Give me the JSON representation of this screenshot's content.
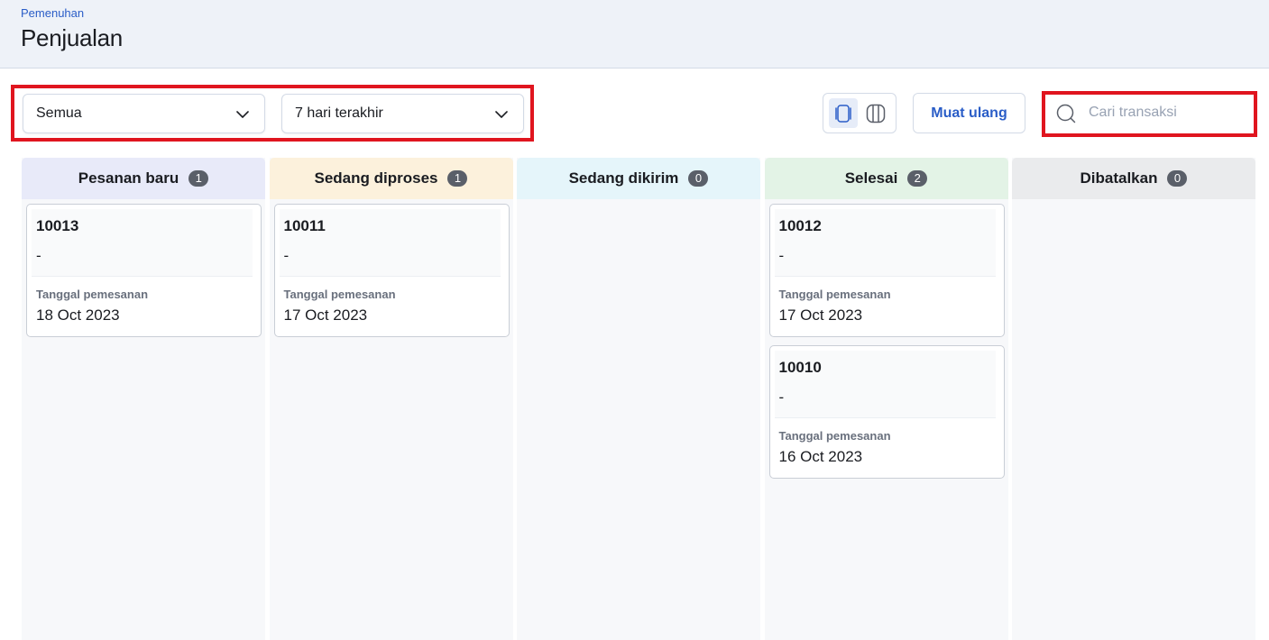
{
  "header": {
    "breadcrumb": "Pemenuhan",
    "title": "Penjualan"
  },
  "toolbar": {
    "status_filter": "Semua",
    "date_filter": "7 hari terakhir",
    "reload_label": "Muat ulang",
    "search_placeholder": "Cari transaksi",
    "view_modes": [
      "kanban-view-icon",
      "columns-view-icon"
    ],
    "active_view": "kanban-view-icon"
  },
  "colors": {
    "accent": "#2a5dc7",
    "highlight": "#e0151f"
  },
  "columns": [
    {
      "title": "Pesanan baru",
      "count": "1",
      "header_color": "#e8eaf9",
      "cards": [
        {
          "id": "10013",
          "subtitle": "-",
          "date_label": "Tanggal pemesanan",
          "date": "18 Oct 2023"
        }
      ]
    },
    {
      "title": "Sedang diproses",
      "count": "1",
      "header_color": "#fcf1dc",
      "cards": [
        {
          "id": "10011",
          "subtitle": "-",
          "date_label": "Tanggal pemesanan",
          "date": "17 Oct 2023"
        }
      ]
    },
    {
      "title": "Sedang dikirim",
      "count": "0",
      "header_color": "#e5f5fa",
      "cards": []
    },
    {
      "title": "Selesai",
      "count": "2",
      "header_color": "#e3f3e6",
      "cards": [
        {
          "id": "10012",
          "subtitle": "-",
          "date_label": "Tanggal pemesanan",
          "date": "17 Oct 2023"
        },
        {
          "id": "10010",
          "subtitle": "-",
          "date_label": "Tanggal pemesanan",
          "date": "16 Oct 2023"
        }
      ]
    },
    {
      "title": "Dibatalkan",
      "count": "0",
      "header_color": "#eaebed",
      "cards": []
    }
  ]
}
